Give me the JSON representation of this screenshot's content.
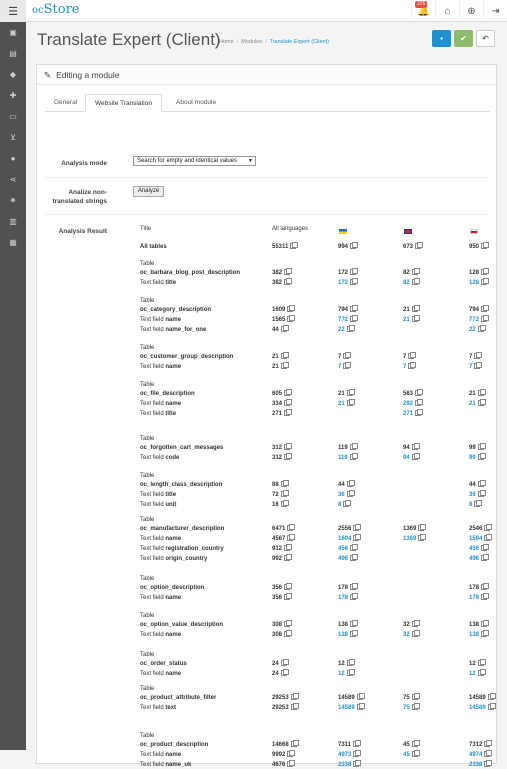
{
  "topbar": {
    "logo_prefix": "oc",
    "logo_main": "Store",
    "notification_count": "376"
  },
  "page": {
    "title": "Translate Expert (Client)"
  },
  "breadcrumb": {
    "home": "Home",
    "modules": "Modules",
    "current": "Translate Expert (Client)"
  },
  "panel": {
    "heading": "Editing a module"
  },
  "tabs": [
    {
      "label": "General"
    },
    {
      "label": "Website Translation"
    },
    {
      "label": "About module"
    }
  ],
  "form": {
    "analysis_mode_label": "Analysis mode",
    "analysis_mode_value": "Search for empty and identical values",
    "analyze_label_1": "Analize non-",
    "analyze_label_2": "translated strings",
    "analyze_button": "Analyze",
    "result_label": "Analysis Result"
  },
  "result": {
    "col_title": "Title",
    "col_all": "All languages",
    "table_word": "Table",
    "textfield_word": "Text field",
    "all_tables": {
      "label": "All tables",
      "all": "55311",
      "ua": "994",
      "gb": "673",
      "ru": "950"
    },
    "groups": [
      {
        "table": "oc_barbara_blog_post_description",
        "rows": [
          {
            "field": "",
            "all": "382",
            "ua": "172",
            "gb": "82",
            "ru": "128"
          },
          {
            "field": "title",
            "all": "382",
            "ua": "172",
            "gb": "82",
            "ru": "128"
          }
        ]
      },
      {
        "table": "oc_category_description",
        "rows": [
          {
            "field": "",
            "all": "1609",
            "ua": "794",
            "gb": "21",
            "ru": "794"
          },
          {
            "field": "name",
            "all": "1565",
            "ua": "772",
            "gb": "21",
            "ru": "772"
          },
          {
            "field": "name_for_one",
            "all": "44",
            "ua": "22",
            "gb": "",
            "ru": "22"
          }
        ]
      },
      {
        "table": "oc_customer_group_description",
        "rows": [
          {
            "field": "",
            "all": "21",
            "ua": "7",
            "gb": "7",
            "ru": "7"
          },
          {
            "field": "name",
            "all": "21",
            "ua": "7",
            "gb": "7",
            "ru": "7"
          }
        ]
      },
      {
        "table": "oc_file_description",
        "rows": [
          {
            "field": "",
            "all": "605",
            "ua": "21",
            "gb": "563",
            "ru": "21"
          },
          {
            "field": "name",
            "all": "334",
            "ua": "21",
            "gb": "292",
            "ru": "21"
          },
          {
            "field": "title",
            "all": "271",
            "ua": "",
            "gb": "271",
            "ru": ""
          }
        ]
      },
      {
        "table": "oc_forgotten_cart_messages",
        "rows": [
          {
            "field": "",
            "all": "312",
            "ua": "119",
            "gb": "94",
            "ru": "99"
          },
          {
            "field": "code",
            "all": "312",
            "ua": "119",
            "gb": "94",
            "ru": "99"
          }
        ]
      },
      {
        "table": "oc_length_class_description",
        "rows": [
          {
            "field": "",
            "all": "88",
            "ua": "44",
            "gb": "",
            "ru": "44"
          },
          {
            "field": "title",
            "all": "72",
            "ua": "36",
            "gb": "",
            "ru": "36"
          },
          {
            "field": "unit",
            "all": "16",
            "ua": "8",
            "gb": "",
            "ru": "8"
          }
        ]
      },
      {
        "table": "oc_manufacturer_description",
        "rows": [
          {
            "field": "",
            "all": "6471",
            "ua": "2556",
            "gb": "1369",
            "ru": "2546"
          },
          {
            "field": "name",
            "all": "4567",
            "ua": "1604",
            "gb": "1369",
            "ru": "1594"
          },
          {
            "field": "registration_country",
            "all": "912",
            "ua": "456",
            "gb": "",
            "ru": "456"
          },
          {
            "field": "origin_country",
            "all": "992",
            "ua": "496",
            "gb": "",
            "ru": "496"
          }
        ]
      },
      {
        "table": "oc_option_description",
        "rows": [
          {
            "field": "",
            "all": "356",
            "ua": "178",
            "gb": "",
            "ru": "178"
          },
          {
            "field": "name",
            "all": "356",
            "ua": "178",
            "gb": "",
            "ru": "178"
          }
        ]
      },
      {
        "table": "oc_option_value_description",
        "rows": [
          {
            "field": "",
            "all": "308",
            "ua": "138",
            "gb": "32",
            "ru": "138"
          },
          {
            "field": "name",
            "all": "308",
            "ua": "138",
            "gb": "32",
            "ru": "138"
          }
        ]
      },
      {
        "table": "oc_order_status",
        "rows": [
          {
            "field": "",
            "all": "24",
            "ua": "12",
            "gb": "",
            "ru": "12"
          },
          {
            "field": "name",
            "all": "24",
            "ua": "12",
            "gb": "",
            "ru": "12"
          }
        ]
      },
      {
        "table": "oc_product_attribute_filter",
        "rows": [
          {
            "field": "",
            "all": "29253",
            "ua": "14589",
            "gb": "75",
            "ru": "14589"
          },
          {
            "field": "text",
            "all": "29253",
            "ua": "14589",
            "gb": "75",
            "ru": "14589"
          }
        ]
      },
      {
        "table": "oc_product_description",
        "rows": [
          {
            "field": "",
            "all": "14668",
            "ua": "7311",
            "gb": "45",
            "ru": "7312"
          },
          {
            "field": "name",
            "all": "9992",
            "ua": "4973",
            "gb": "45",
            "ru": "4974"
          },
          {
            "field": "name_uk",
            "all": "4676",
            "ua": "2338",
            "gb": "",
            "ru": "2338"
          }
        ]
      }
    ]
  }
}
